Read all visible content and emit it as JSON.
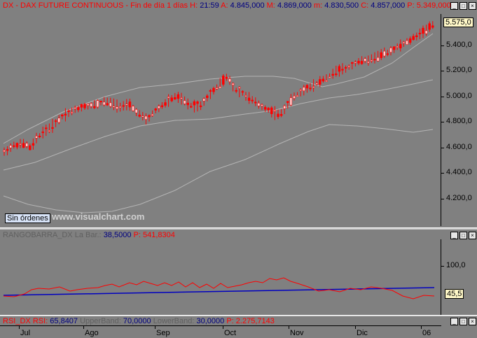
{
  "price_pane": {
    "header_prefix": "DX - DAX FUTURE CONTINUOUS - Fin de día 1 días",
    "h_label": "H:",
    "h_value": "21:59",
    "a_label": "A:",
    "a_value": "4.845,000",
    "m_label": "M:",
    "m_value": "4.869,000",
    "mi_label": "m:",
    "mi_value": "4.830,500",
    "c_label": "C:",
    "c_value": "4.857,000",
    "p_label": "P:",
    "p_value": "5.349,000",
    "current_value": "5.575,0",
    "y_ticks": [
      "5.400,0",
      "5.200,0",
      "5.000,0",
      "4.800,0",
      "4.600,0",
      "4.400,0",
      "4.200,0"
    ],
    "sin_ordenes": "Sin órdenes",
    "watermark": "www.visualchart.com"
  },
  "middle_pane": {
    "header_name": "RANGOBARRA_DX",
    "header_mid": "La Bar.:",
    "value1": "38,5000",
    "p_label": "P:",
    "p_value": "541,8304"
  },
  "rsi_pane": {
    "header_name": "RSI_DX",
    "rsi_label": "RSI:",
    "rsi_value": "65,8407",
    "upper_label": "UpperBand:",
    "upper_value": "70,0000",
    "lower_label": "LowerBand:",
    "lower_value": "30,0000",
    "p_label": "P:",
    "p_value": "2.275,7143",
    "current_value": "45,5",
    "y_tick": "100,0"
  },
  "x_axis": {
    "months": [
      "Jul",
      "Ago",
      "Sep",
      "Oct",
      "Nov",
      "Dic",
      "06"
    ]
  },
  "colors": {
    "background": "#808080",
    "candle": "#ff0000",
    "band": "#b4b4b4",
    "rsi": "#ff0000",
    "baseline": "#0000c0",
    "header_red": "#ff0000",
    "header_blue": "#0000a0"
  }
}
